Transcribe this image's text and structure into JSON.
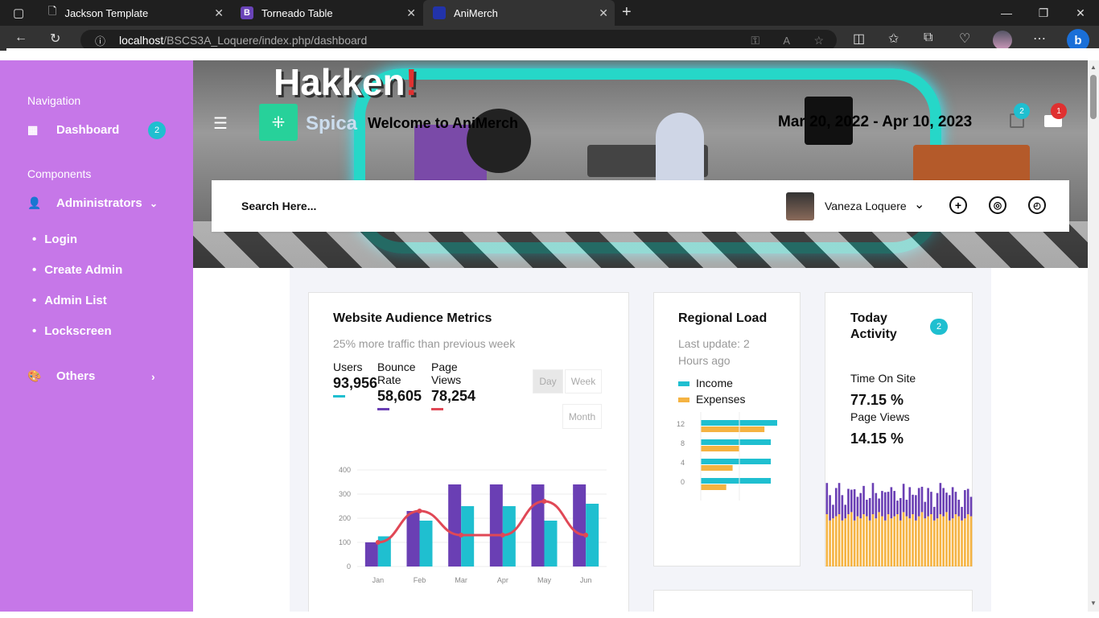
{
  "browser": {
    "tabs": [
      {
        "title": "Jackson Template"
      },
      {
        "title": "Torneado Table"
      },
      {
        "title": "AniMerch"
      }
    ],
    "url_host": "localhost",
    "url_path": "/BSCS3A_Loquere/index.php/dashboard"
  },
  "sidebar": {
    "navigation_heading": "Navigation",
    "dashboard_label": "Dashboard",
    "dashboard_badge": "2",
    "components_heading": "Components",
    "administrators_label": "Administrators",
    "sub_items": [
      "Login",
      "Create Admin",
      "Admin List",
      "Lockscreen"
    ],
    "others_label": "Others"
  },
  "hero": {
    "shop_sign": "Hakken",
    "shop_sign_mark": "!"
  },
  "topbar": {
    "brand": "Spica",
    "welcome": "Welcome to AniMerch",
    "date_range": "Mar 20, 2022 - Apr 10, 2023",
    "cart_badge": "2",
    "mail_badge": "1"
  },
  "search": {
    "placeholder": "Search Here...",
    "user_name": "Vaneza Loquere"
  },
  "audience": {
    "title": "Website Audience Metrics",
    "subtitle": "25% more traffic than previous week",
    "users_label": "Users",
    "users_value": "93,956",
    "bounce_label_1": "Bounce",
    "bounce_label_2": "Rate",
    "bounce_value": "58,605",
    "pageviews_label_1": "Page",
    "pageviews_label_2": "Views",
    "pageviews_value": "78,254",
    "btn_day": "Day",
    "btn_week": "Week",
    "btn_month": "Month"
  },
  "regional": {
    "title": "Regional Load",
    "subtitle_1": "Last update: 2",
    "subtitle_2": "Hours ago",
    "legend_income": "Income",
    "legend_expenses": "Expenses"
  },
  "activity": {
    "title_1": "Today",
    "title_2": "Activity",
    "badge": "2",
    "time_on_site_label": "Time On Site",
    "time_on_site_value": "77.15 %",
    "page_views_label": "Page Views",
    "page_views_value": "14.15 %"
  },
  "colors": {
    "sidebar": "#c677e8",
    "teal": "#1fbfd0",
    "purple": "#6a3fb4",
    "red": "#e04856",
    "orange": "#f5b342"
  },
  "chart_data": [
    {
      "type": "bar",
      "categories": [
        "Jan",
        "Feb",
        "Mar",
        "Apr",
        "May",
        "Jun"
      ],
      "series": [
        {
          "values": [
            100,
            230,
            340,
            340,
            340,
            340
          ]
        },
        {
          "values": [
            125,
            190,
            250,
            250,
            190,
            260
          ]
        },
        {
          "type": "line",
          "values": [
            100,
            230,
            130,
            130,
            270,
            130
          ]
        }
      ],
      "ylim": [
        0,
        400
      ],
      "yticks": [
        "0",
        "100",
        "200",
        "300",
        "400"
      ]
    },
    {
      "type": "bar",
      "orientation": "horizontal",
      "categories": [
        "12",
        "8",
        "4",
        "0"
      ],
      "series": [
        {
          "name": "Income",
          "values": [
            12,
            11,
            11,
            11
          ]
        },
        {
          "name": "Expenses",
          "values": [
            10,
            6,
            5,
            4
          ]
        }
      ]
    },
    {
      "type": "bar",
      "stacked": true,
      "series": [
        {
          "values": [
            32,
            30,
            26,
            31,
            32,
            30,
            26,
            30,
            29,
            32,
            28,
            30,
            31,
            27,
            29,
            32,
            30,
            26,
            30,
            31,
            29,
            32,
            30,
            26,
            29,
            31,
            27,
            32,
            28,
            30,
            31,
            30,
            27,
            31,
            29,
            26,
            30,
            32,
            31,
            28,
            30,
            32,
            29,
            27,
            26,
            31,
            30,
            28
          ]
        },
        {
          "values": [
            25,
            22,
            23,
            24,
            25,
            22,
            23,
            25,
            26,
            22,
            24,
            23,
            25,
            24,
            22,
            25,
            23,
            26,
            24,
            22,
            25,
            23,
            24,
            25,
            22,
            26,
            24,
            23,
            25,
            22,
            24,
            26,
            23,
            24,
            25,
            22,
            23,
            25,
            24,
            26,
            22,
            23,
            25,
            24,
            22,
            23,
            25,
            24
          ]
        }
      ]
    }
  ]
}
